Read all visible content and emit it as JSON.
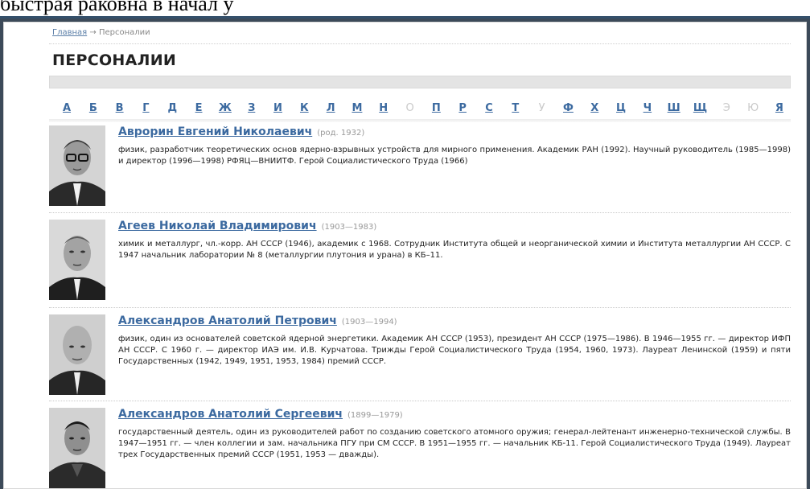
{
  "top_fragment": "быстрая раковна в начал у",
  "breadcrumb": {
    "home": "Главная",
    "arrow": "→",
    "current": "Персоналии"
  },
  "page_title": "ПЕРСОНАЛИИ",
  "alphabet": [
    {
      "letter": "А",
      "active": true
    },
    {
      "letter": "Б",
      "active": true
    },
    {
      "letter": "В",
      "active": true
    },
    {
      "letter": "Г",
      "active": true
    },
    {
      "letter": "Д",
      "active": true
    },
    {
      "letter": "Е",
      "active": true
    },
    {
      "letter": "Ж",
      "active": true
    },
    {
      "letter": "З",
      "active": true
    },
    {
      "letter": "И",
      "active": true
    },
    {
      "letter": "К",
      "active": true
    },
    {
      "letter": "Л",
      "active": true
    },
    {
      "letter": "М",
      "active": true
    },
    {
      "letter": "Н",
      "active": true
    },
    {
      "letter": "О",
      "active": false
    },
    {
      "letter": "П",
      "active": true
    },
    {
      "letter": "Р",
      "active": true
    },
    {
      "letter": "С",
      "active": true
    },
    {
      "letter": "Т",
      "active": true
    },
    {
      "letter": "У",
      "active": false
    },
    {
      "letter": "Ф",
      "active": true
    },
    {
      "letter": "Х",
      "active": true
    },
    {
      "letter": "Ц",
      "active": true
    },
    {
      "letter": "Ч",
      "active": true
    },
    {
      "letter": "Ш",
      "active": true
    },
    {
      "letter": "Щ",
      "active": true
    },
    {
      "letter": "Э",
      "active": false
    },
    {
      "letter": "Ю",
      "active": false
    },
    {
      "letter": "Я",
      "active": true
    }
  ],
  "persons": [
    {
      "name": "Аврорин Евгений Николаевич",
      "years": "(род. 1932)",
      "description": "физик, разработчик теоретических основ ядерно-взрывных устройств для мирного применения. Академик РАН (1992). Научный руководитель (1985—1998) и директор (1996—1998) РФЯЦ—ВНИИТФ. Герой Социалистического Труда (1966)"
    },
    {
      "name": "Агеев Николай Владимирович",
      "years": "(1903—1983)",
      "description": "химик и металлург, чл.-корр. АН СССР (1946), академик с 1968. Сотрудник Института общей и неорганической химии и Института металлургии АН СССР. С 1947 начальник лаборатории № 8 (металлургии плутония и урана) в КБ–11."
    },
    {
      "name": "Александров Анатолий Петрович",
      "years": "(1903—1994)",
      "description": "физик, один из основателей советской ядерной энергетики. Академик АН СССР (1953), президент АН СССР (1975—1986). В 1946—1955 гг. — директор ИФП АН СССР. С 1960 г. — директор ИАЭ им. И.В. Курчатова. Трижды Герой Социалистического Труда (1954, 1960, 1973). Лауреат Ленинской (1959) и пяти Государственных (1942, 1949, 1951, 1953, 1984) премий СССР."
    },
    {
      "name": "Александров Анатолий Сергеевич",
      "years": "(1899—1979)",
      "description": "государственный деятель, один из руководителей работ по созданию советского атомного оружия; генерал-лейтенант инженерно-технической службы. В 1947—1951 гг. — член коллегии и зам. начальника ПГУ при СМ СССР. В 1951—1955 гг. — начальник КБ-11. Герой Социалистического Труда (1949). Лауреат трех Государственных премий СССР (1951, 1953 — дважды)."
    }
  ],
  "colors": {
    "link": "#3c6aa0",
    "frame": "#3c4a59",
    "muted": "#999999"
  }
}
